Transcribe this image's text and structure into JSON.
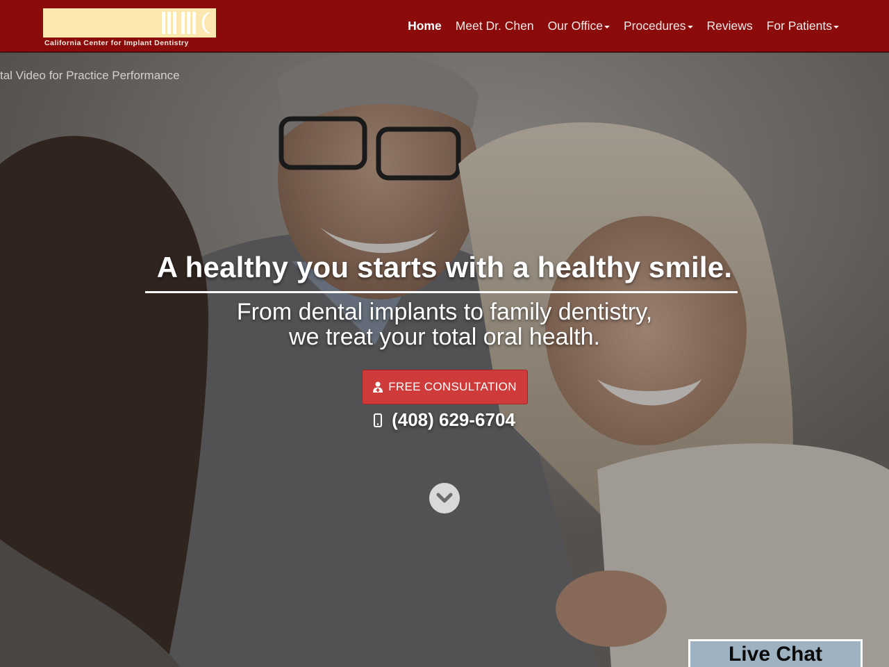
{
  "header": {
    "logo_text": "California Center for Implant Dentistry",
    "brand_color": "#8b0a0a",
    "nav": [
      {
        "label": "Home",
        "active": true,
        "has_dropdown": false
      },
      {
        "label": "Meet Dr. Chen",
        "active": false,
        "has_dropdown": false
      },
      {
        "label": "Our Office",
        "active": false,
        "has_dropdown": true
      },
      {
        "label": "Procedures",
        "active": false,
        "has_dropdown": true
      },
      {
        "label": "Reviews",
        "active": false,
        "has_dropdown": false
      },
      {
        "label": "For Patients",
        "active": false,
        "has_dropdown": true
      }
    ]
  },
  "hero": {
    "video_caption": "tal Video for Practice Performance",
    "headline": "A healthy you starts with a healthy smile.",
    "subline_1": "From dental implants to family dentistry,",
    "subline_2": "we treat your total oral health.",
    "cta_label": "FREE CONSULTATION",
    "cta_icon": "user-doctor-icon",
    "cta_color": "#cf3a3a",
    "phone": "(408) 629-6704",
    "phone_icon": "mobile-phone-icon",
    "scroll_icon": "chevron-down-circle-icon"
  },
  "live_chat": {
    "label": "Live Chat"
  }
}
